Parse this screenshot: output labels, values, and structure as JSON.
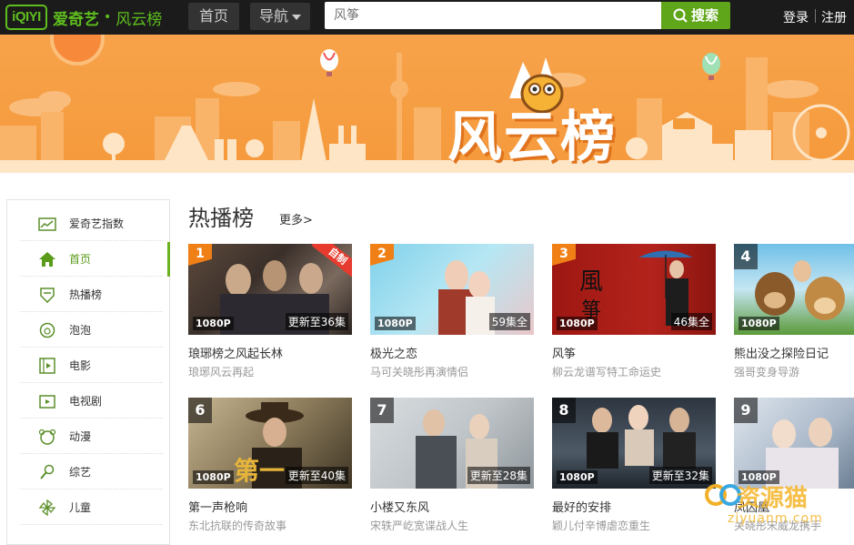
{
  "header": {
    "logo": "iQIYI",
    "brand": "爱奇艺",
    "dot": "•",
    "subbrand": "风云榜",
    "nav_home": "首页",
    "nav_guide": "导航",
    "search_placeholder": "风筝",
    "search_button": "搜索",
    "login": "登录",
    "register": "注册"
  },
  "banner": {
    "title": "风云榜",
    "logo_badge": "iQIYI"
  },
  "sidebar": {
    "items": [
      {
        "label": "爱奇艺指数",
        "icon": "chart-icon"
      },
      {
        "label": "首页",
        "icon": "home-icon"
      },
      {
        "label": "热播榜",
        "icon": "shield-icon"
      },
      {
        "label": "泡泡",
        "icon": "bubble-icon"
      },
      {
        "label": "电影",
        "icon": "film-icon"
      },
      {
        "label": "电视剧",
        "icon": "tv-icon"
      },
      {
        "label": "动漫",
        "icon": "cartoon-icon"
      },
      {
        "label": "综艺",
        "icon": "microphone-icon"
      },
      {
        "label": "儿童",
        "icon": "pinwheel-icon"
      }
    ]
  },
  "main": {
    "section_title": "热播榜",
    "more": "更多>",
    "cards": [
      {
        "rank": "1",
        "title": "琅琊榜之风起长林",
        "desc": "琅琊风云再起",
        "quality": "1080P",
        "update": "更新至36集",
        "badge": "自制"
      },
      {
        "rank": "2",
        "title": "极光之恋",
        "desc": "马可关晓彤再演情侣",
        "quality": "1080P",
        "update": "59集全"
      },
      {
        "rank": "3",
        "title": "风筝",
        "desc": "柳云龙谱写特工命运史",
        "quality": "1080P",
        "update": "46集全"
      },
      {
        "rank": "4",
        "title": "熊出没之探险日记",
        "desc": "强哥变身导游",
        "quality": "1080P",
        "update": ""
      },
      {
        "rank": "6",
        "title": "第一声枪响",
        "desc": "东北抗联的传奇故事",
        "quality": "1080P",
        "update": "更新至40集"
      },
      {
        "rank": "7",
        "title": "小楼又东风",
        "desc": "宋轶严屹宽谍战人生",
        "quality": "",
        "update": "更新至28集"
      },
      {
        "rank": "8",
        "title": "最好的安排",
        "desc": "颖儿付辛博虐恋重生",
        "quality": "1080P",
        "update": "更新至32集"
      },
      {
        "rank": "9",
        "title": "凤囚凰",
        "desc": "关晓彤宋威龙携手",
        "quality": "1080P",
        "update": ""
      }
    ]
  },
  "watermark": {
    "text": "资源猫",
    "url": "ziyuanm.com"
  },
  "colors": {
    "brand_green": "#5fbe1e",
    "banner_orange": "#f7a24a",
    "rank_orange": "#f08016"
  }
}
